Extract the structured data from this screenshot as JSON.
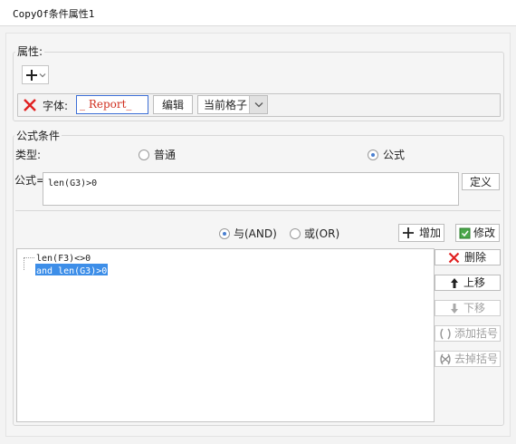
{
  "window": {
    "title": "CopyOf条件属性1"
  },
  "properties": {
    "group_label": "属性:",
    "font_label": "字体:",
    "font_preview": "_ Report_",
    "edit_label": "编辑",
    "scope_value": "当前格子",
    "colors": {
      "delete_x": "#e02020",
      "preview_border": "#3d6fd6",
      "preview_text": "#d03020"
    }
  },
  "formula": {
    "group_label": "公式条件",
    "type_label": "类型:",
    "type_options": [
      {
        "label": "普通",
        "selected": false
      },
      {
        "label": "公式",
        "selected": true
      }
    ],
    "formula_label": "公式=",
    "formula_value": "len(G3)>0",
    "define_label": "定义",
    "logic_options": [
      {
        "label": "与(AND)",
        "selected": true
      },
      {
        "label": "或(OR)",
        "selected": false
      }
    ],
    "add_label": "增加",
    "modify_label": "修改",
    "conditions": [
      "len(F3)<>0",
      "and len(G3)>0"
    ],
    "selected_index": 1,
    "selection_color": "#3d8ee8"
  },
  "side_buttons": {
    "delete": "删除",
    "up": "上移",
    "down": "下移",
    "add_paren": "添加括号",
    "remove_paren": "去掉括号"
  }
}
